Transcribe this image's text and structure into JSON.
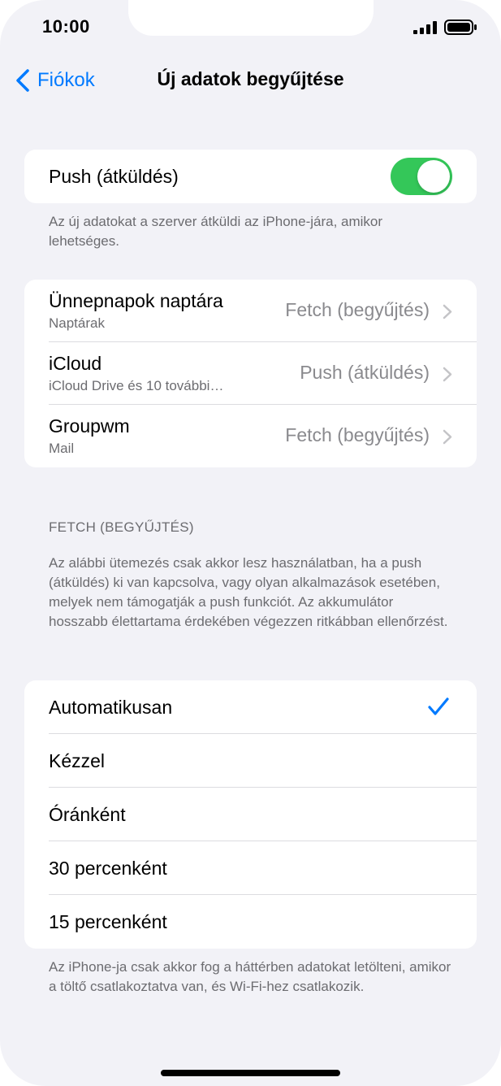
{
  "status_bar": {
    "time": "10:00",
    "signal_icon": "cellular-signal-icon",
    "battery_icon": "battery-icon"
  },
  "nav": {
    "back_label": "Fiókok",
    "back_icon": "chevron-left-icon",
    "title": "Új adatok begyűjtése"
  },
  "push": {
    "label": "Push (átküldés)",
    "enabled": true,
    "footnote": "Az új adatokat a szerver átküldi az iPhone-jára, amikor lehetséges."
  },
  "accounts": [
    {
      "name": "Ünnepnapok naptára",
      "detail": "Naptárak",
      "value": "Fetch (begyűjtés)"
    },
    {
      "name": "iCloud",
      "detail": "iCloud Drive és 10 további…",
      "value": "Push (átküldés)"
    },
    {
      "name": "Groupwm",
      "detail": "Mail",
      "value": "Fetch (begyűjtés)"
    }
  ],
  "fetch": {
    "header": "FETCH (BEGYŰJTÉS)",
    "description": "Az alábbi ütemezés csak akkor lesz használatban, ha a push (átküldés) ki van kapcsolva, vagy olyan alkalmazások esetében, melyek nem támogatják a push funkciót. Az akkumulátor hosszabb élettartama érdekében végezzen ritkábban ellenőrzést.",
    "options": [
      "Automatikusan",
      "Kézzel",
      "Óránként",
      "30 percenként",
      "15 percenként"
    ],
    "selected": "Automatikusan",
    "footnote": "Az iPhone-ja csak akkor fog a háttérben adatokat letölteni, amikor a töltő csatlakoztatva van, és Wi-Fi-hez csatlakozik."
  },
  "colors": {
    "accent": "#007aff",
    "toggle_on": "#34c759",
    "background": "#f2f2f7"
  }
}
